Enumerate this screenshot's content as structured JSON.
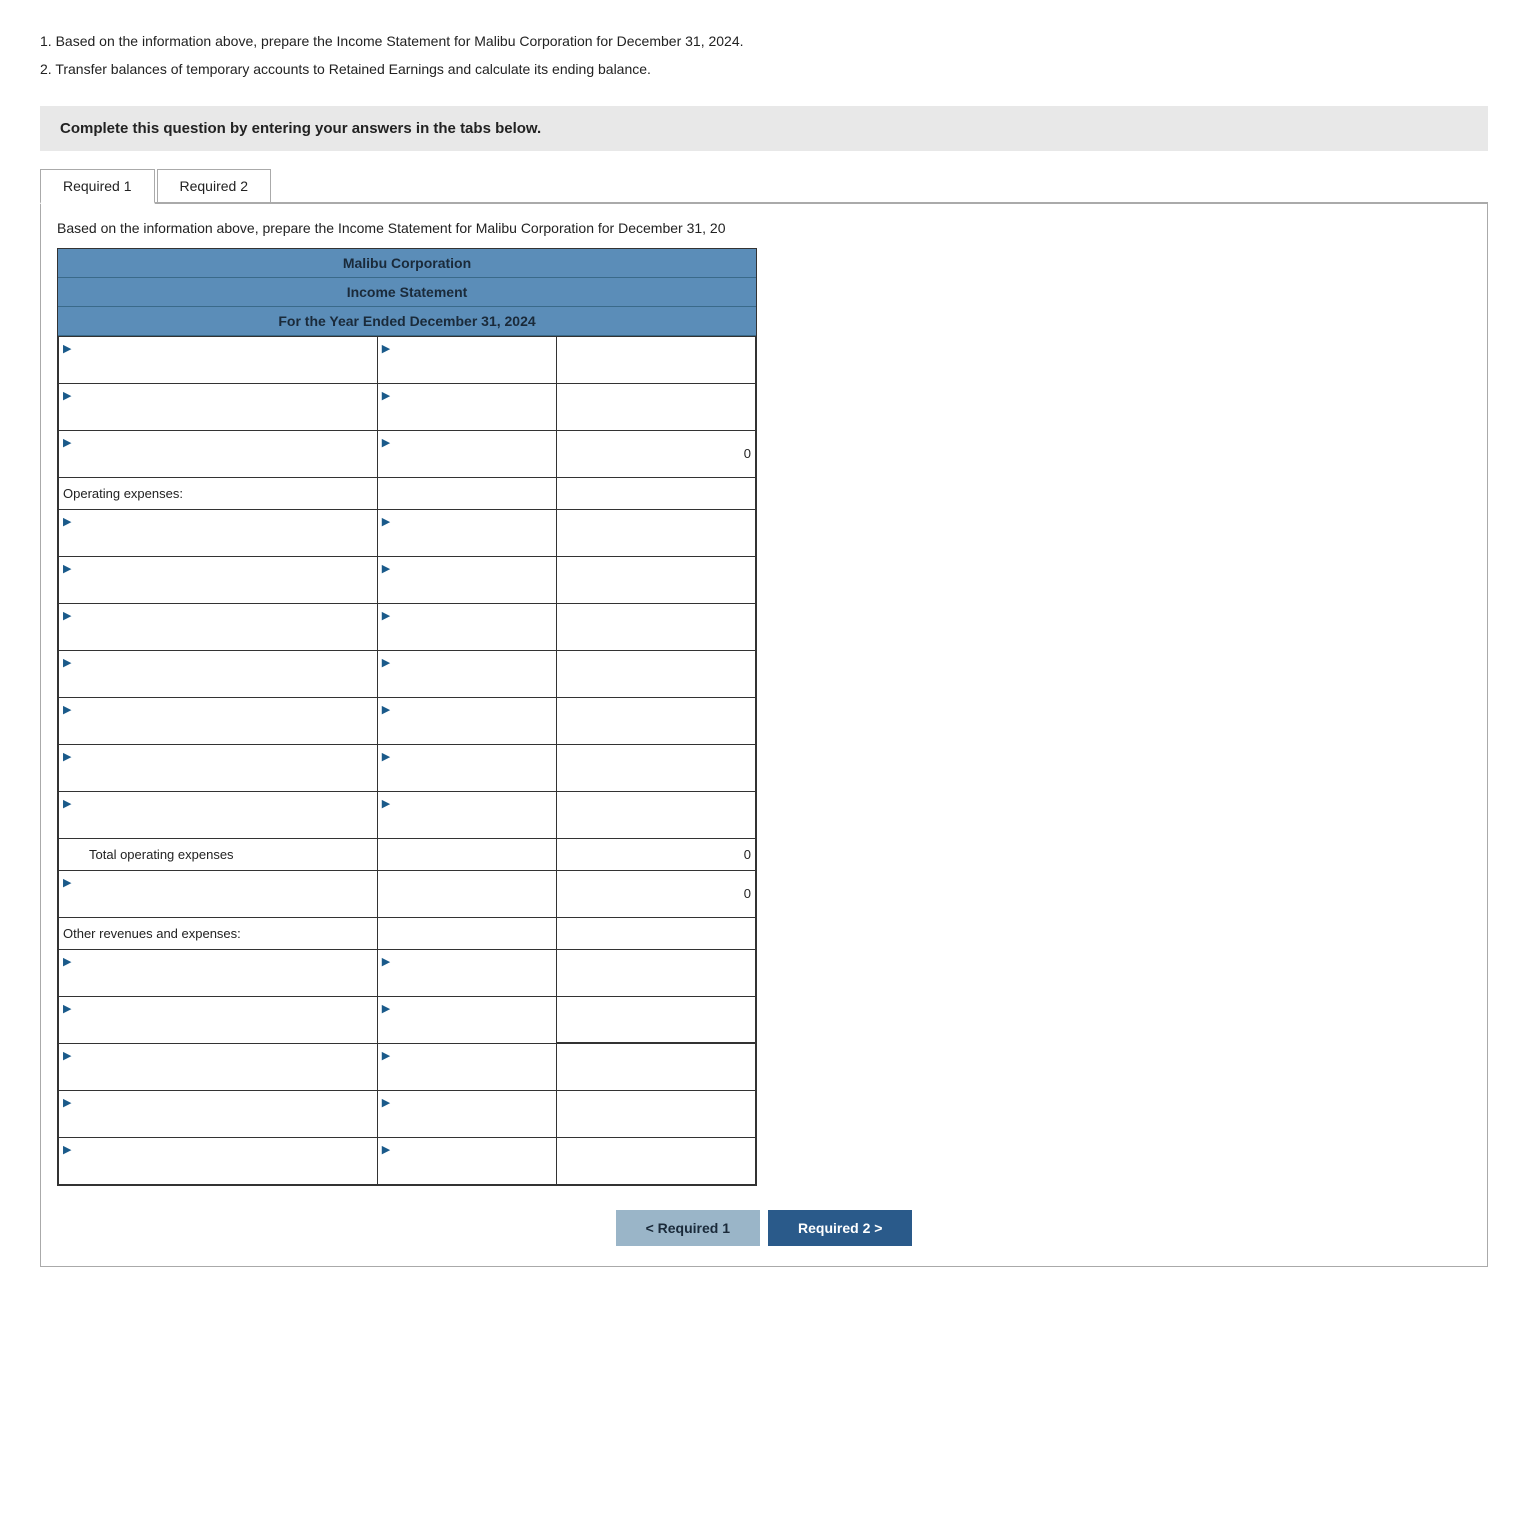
{
  "instructions": {
    "item1": "1. Based on the information above, prepare the Income Statement for Malibu Corporation for December 31, 2024.",
    "item2": "2. Transfer balances of temporary accounts to Retained Earnings and calculate its ending balance."
  },
  "complete_notice": "Complete this question by entering your answers in the tabs below.",
  "tabs": [
    {
      "id": "req1",
      "label": "Required 1",
      "active": true
    },
    {
      "id": "req2",
      "label": "Required 2",
      "active": false
    }
  ],
  "tab_description": "Based on the information above, prepare the Income Statement for Malibu Corporation for December 31, 20",
  "table": {
    "corp_name": "Malibu Corporation",
    "stmt_title": "Income Statement",
    "period": "For the Year Ended December 31, 2024",
    "rows": [
      {
        "type": "input_row",
        "has_arrow": true
      },
      {
        "type": "input_row",
        "has_arrow": true
      },
      {
        "type": "input_row_value",
        "has_arrow": true,
        "value": "0"
      },
      {
        "type": "label_row",
        "label": "Operating expenses:"
      },
      {
        "type": "input_row",
        "has_arrow": true
      },
      {
        "type": "input_row",
        "has_arrow": true
      },
      {
        "type": "input_row",
        "has_arrow": true
      },
      {
        "type": "input_row",
        "has_arrow": true
      },
      {
        "type": "input_row",
        "has_arrow": true
      },
      {
        "type": "input_row",
        "has_arrow": true
      },
      {
        "type": "input_row",
        "has_arrow": true
      },
      {
        "type": "total_row",
        "label": "Total operating expenses",
        "value": "0"
      },
      {
        "type": "subtotal_row",
        "value": "0"
      },
      {
        "type": "label_row",
        "label": "Other revenues and expenses:"
      },
      {
        "type": "input_row",
        "has_arrow": true
      },
      {
        "type": "input_row",
        "has_arrow": true
      },
      {
        "type": "input_row",
        "has_arrow": true
      },
      {
        "type": "input_row",
        "has_arrow": true
      },
      {
        "type": "input_row",
        "has_arrow": true
      }
    ]
  },
  "nav": {
    "prev_label": "< Required 1",
    "next_label": "Required 2 >"
  }
}
